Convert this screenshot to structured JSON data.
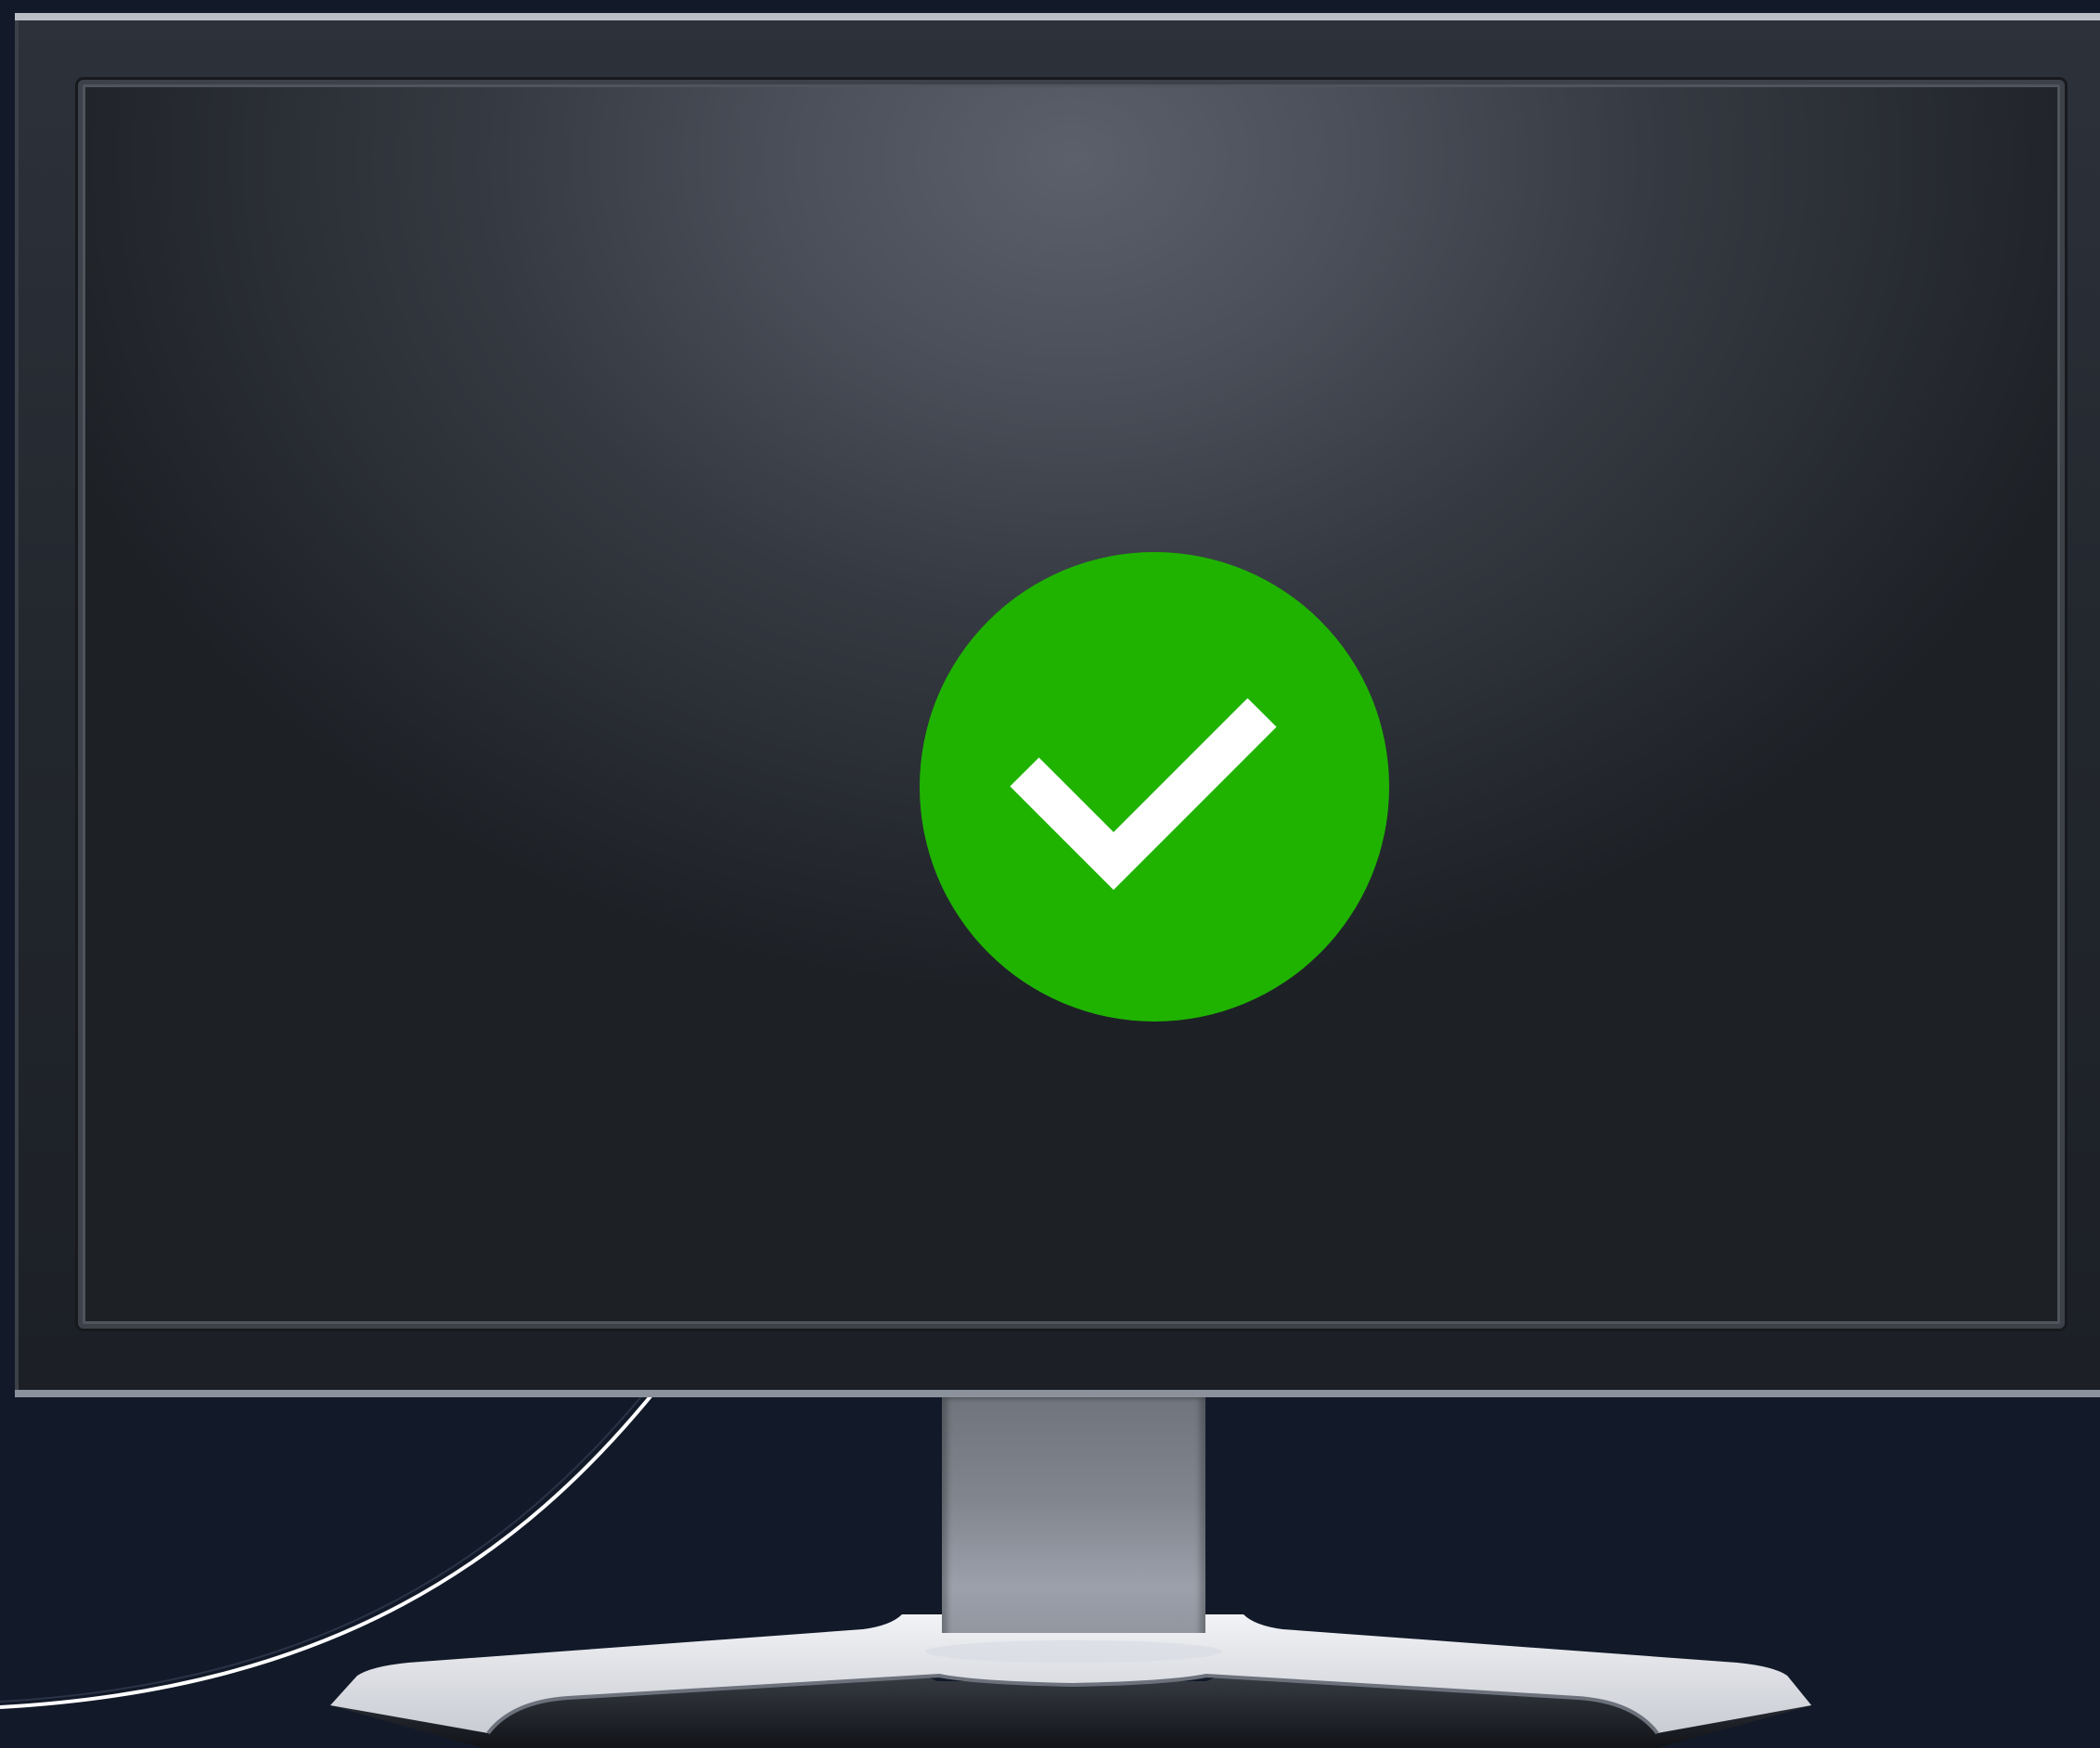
{
  "scene": {
    "description_colors": {
      "background": "#121a29",
      "bezel": "#23272e",
      "screen_glow": "#5c606a",
      "badge": "#1fb300",
      "check": "#ffffff",
      "stand": "#9ba0aa"
    },
    "icons": {
      "status": "check-circle-icon"
    }
  }
}
